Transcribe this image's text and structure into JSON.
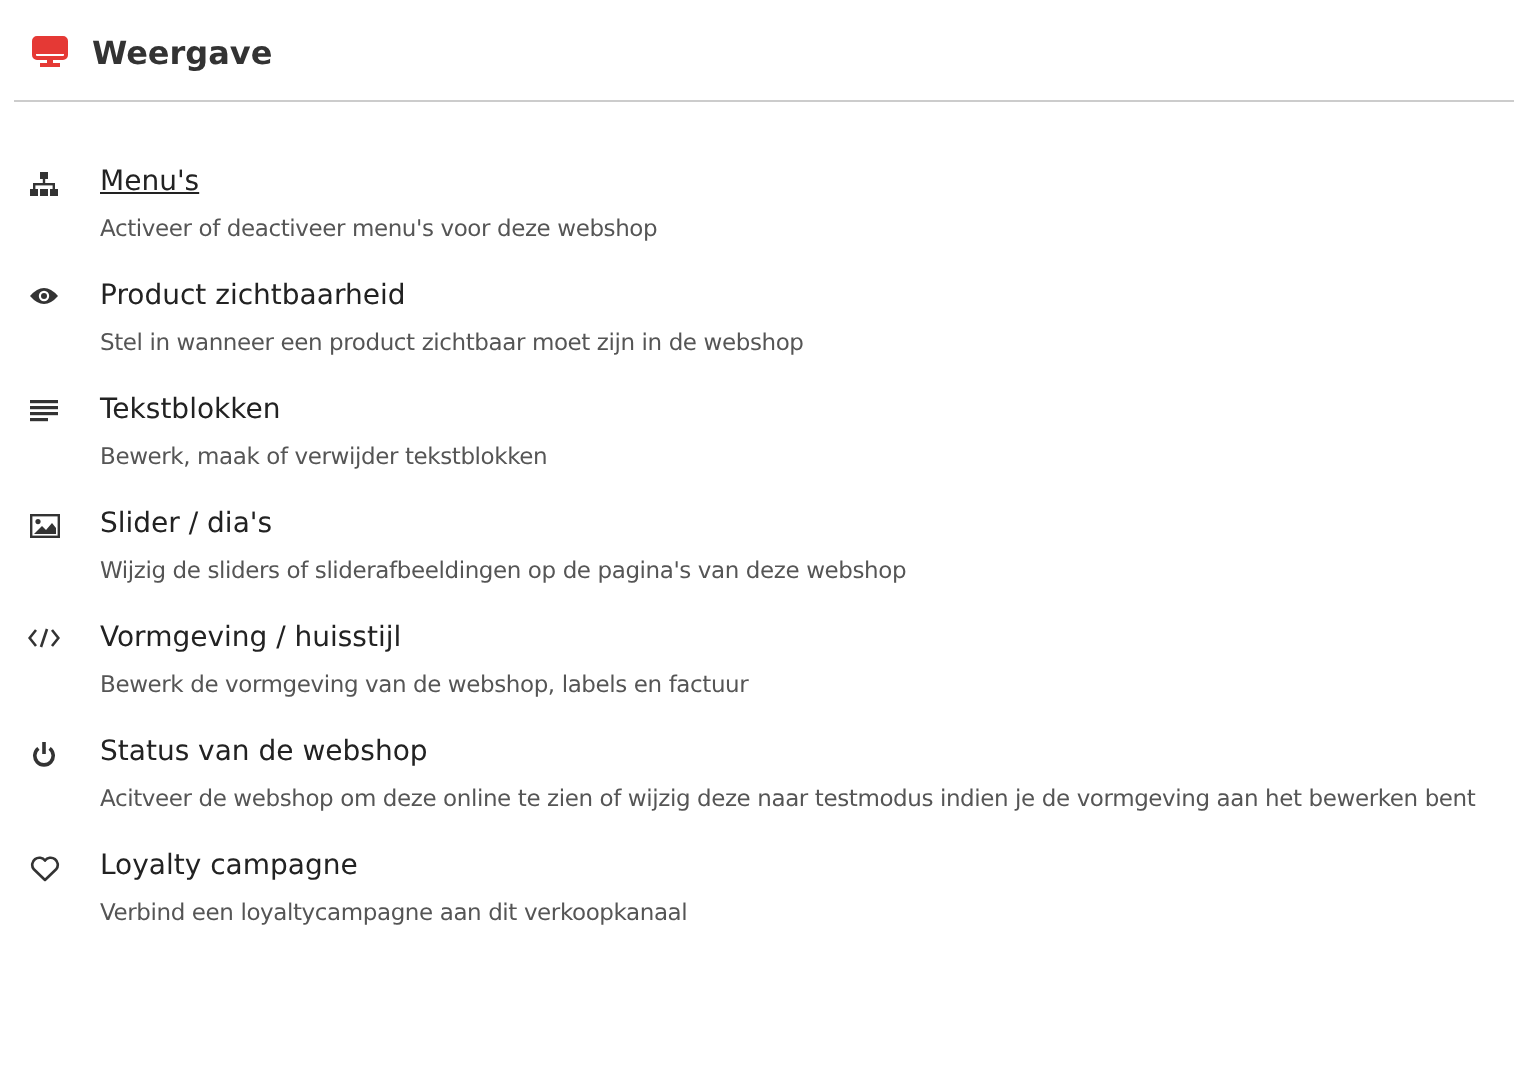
{
  "header": {
    "title": "Weergave"
  },
  "items": [
    {
      "title": "Menu's",
      "description": "Activeer of deactiveer menu's voor deze webshop",
      "hovered": true
    },
    {
      "title": "Product zichtbaarheid",
      "description": "Stel in wanneer een product zichtbaar moet zijn in de webshop",
      "hovered": false
    },
    {
      "title": "Tekstblokken",
      "description": "Bewerk, maak of verwijder tekstblokken",
      "hovered": false
    },
    {
      "title": "Slider / dia's",
      "description": "Wijzig de sliders of sliderafbeeldingen op de pagina's van deze webshop",
      "hovered": false
    },
    {
      "title": "Vormgeving / huisstijl",
      "description": "Bewerk de vormgeving van de webshop, labels en factuur",
      "hovered": false
    },
    {
      "title": "Status van de webshop",
      "description": "Acitveer de webshop om deze online te zien of wijzig deze naar testmodus indien je de vormgeving aan het bewerken bent",
      "hovered": false
    },
    {
      "title": "Loyalty campagne",
      "description": "Verbind een loyaltycampagne aan dit verkoopkanaal",
      "hovered": false
    }
  ]
}
